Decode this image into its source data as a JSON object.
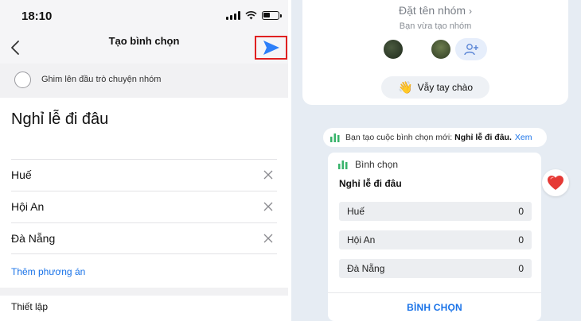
{
  "status_bar": {
    "time": "18:10"
  },
  "create_poll": {
    "title": "Tạo bình chọn",
    "pin_label": "Ghim lên đầu trò chuyện nhóm",
    "question": "Nghỉ lễ đi đâu",
    "options": [
      {
        "label": "Huế"
      },
      {
        "label": "Hội An"
      },
      {
        "label": "Đà Nẵng"
      }
    ],
    "add_option": "Thêm phương án",
    "settings_label": "Thiết lập"
  },
  "chat": {
    "group_name": "Đặt tên nhóm",
    "group_sub": "Bạn vừa tạo nhóm",
    "wave_label": "Vẫy tay chào",
    "notice_prefix": "Bạn tạo cuộc bình chọn mới:",
    "notice_bold": "Nghỉ lễ đi đâu.",
    "notice_link": "Xem",
    "poll": {
      "header": "Bình chọn",
      "question": "Nghỉ lễ đi đâu",
      "options": [
        {
          "label": "Huế",
          "count": "0"
        },
        {
          "label": "Hội An",
          "count": "0"
        },
        {
          "label": "Đà Nẵng",
          "count": "0"
        }
      ],
      "vote_button": "BÌNH CHỌN"
    }
  },
  "colors": {
    "accent": "#1a73e8",
    "highlight_border": "#e02020",
    "reaction": "#e53935"
  }
}
